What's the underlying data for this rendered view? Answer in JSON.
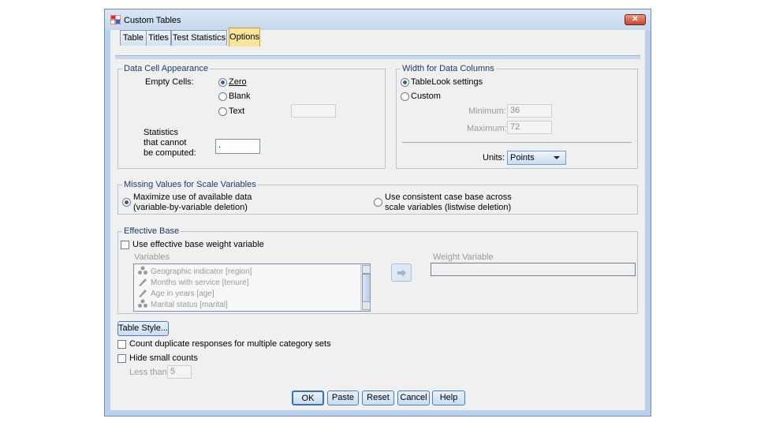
{
  "window": {
    "title": "Custom Tables",
    "close_label": "✕"
  },
  "tabs": [
    {
      "label": "Table",
      "active": false
    },
    {
      "label": "Titles",
      "active": false
    },
    {
      "label": "Test Statistics",
      "active": false
    },
    {
      "label": "Options",
      "active": true
    }
  ],
  "data_cell": {
    "legend": "Data Cell Appearance",
    "empty_cells_label": "Empty Cells:",
    "options": [
      "Zero",
      "Blank",
      "Text"
    ],
    "selected": "Zero",
    "text_value": "",
    "stats_label_1": "Statistics",
    "stats_label_2": "that cannot",
    "stats_label_3": "be computed:",
    "stats_value": "."
  },
  "width_cols": {
    "legend": "Width for Data Columns",
    "options": [
      "TableLook settings",
      "Custom"
    ],
    "selected": "TableLook settings",
    "minimum_label": "Minimum:",
    "minimum_value": "36",
    "maximum_label": "Maximum:",
    "maximum_value": "72",
    "units_label": "Units:",
    "units_value": "Points"
  },
  "missing": {
    "legend": "Missing Values for Scale Variables",
    "opt1_line1": "Maximize use of available data",
    "opt1_line2": "(variable-by-variable deletion)",
    "opt2_line1": "Use consistent case base across",
    "opt2_line2": "scale variables (listwise deletion)",
    "selected": "opt1"
  },
  "effective_base": {
    "legend": "Effective Base",
    "checkbox_label": "Use effective base weight variable",
    "checked": false,
    "variables_label": "Variables",
    "weight_label": "Weight Variable",
    "variables": [
      {
        "name": "Geographic indicator [region]",
        "icon": "nominal-icon"
      },
      {
        "name": "Months with service [tenure]",
        "icon": "scale-icon"
      },
      {
        "name": "Age in years [age]",
        "icon": "scale-icon"
      },
      {
        "name": "Marital status [marital]",
        "icon": "nominal-icon"
      }
    ],
    "weight_value": ""
  },
  "table_style_button": "Table Style...",
  "count_dup_label": "Count duplicate responses for multiple category sets",
  "hide_small_label": "Hide small counts",
  "less_than_label": "Less than",
  "less_than_value": "5",
  "buttons": {
    "ok": "OK",
    "paste": "Paste",
    "reset": "Reset",
    "cancel": "Cancel",
    "help": "Help"
  },
  "colors": {
    "title_bar": "#c4d8ee",
    "active_tab": "#fbe59a",
    "group_legend": "#1b3a6b"
  }
}
